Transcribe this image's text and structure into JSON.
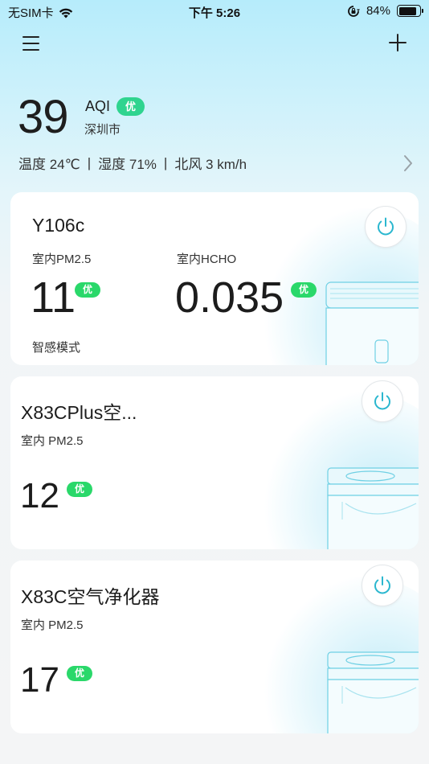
{
  "status_bar": {
    "carrier": "无SIM卡",
    "time": "下午 5:26",
    "battery_percent": "84%",
    "battery_level": 0.84,
    "wifi_icon": "wifi-icon",
    "rotation_lock_icon": "rotation-lock-icon"
  },
  "nav": {
    "menu_icon": "menu-icon",
    "add_icon": "plus-icon"
  },
  "weather": {
    "aqi_value": "39",
    "aqi_label": "AQI",
    "aqi_level": "优",
    "city": "深圳市",
    "temperature": "温度 24℃",
    "humidity": "湿度 71%",
    "wind": "北风 3 km/h",
    "separator": "|"
  },
  "devices": [
    {
      "name": "Y106c",
      "metrics": [
        {
          "label": "室内PM2.5",
          "value": "11",
          "level": "优"
        },
        {
          "label": "室内HCHO",
          "value": "0.035",
          "level": "优"
        }
      ],
      "mode": "智感模式"
    },
    {
      "name": "X83CPlus空...",
      "metrics": [
        {
          "label": "室内 PM2.5",
          "value": "12",
          "level": "优"
        }
      ]
    },
    {
      "name": "X83C空气净化器",
      "metrics": [
        {
          "label": "室内 PM2.5",
          "value": "17",
          "level": "优"
        }
      ]
    }
  ],
  "colors": {
    "accent_cyan": "#2bb7cf",
    "aqi_good": "#2fd48f",
    "metric_good": "#2ad86a"
  }
}
